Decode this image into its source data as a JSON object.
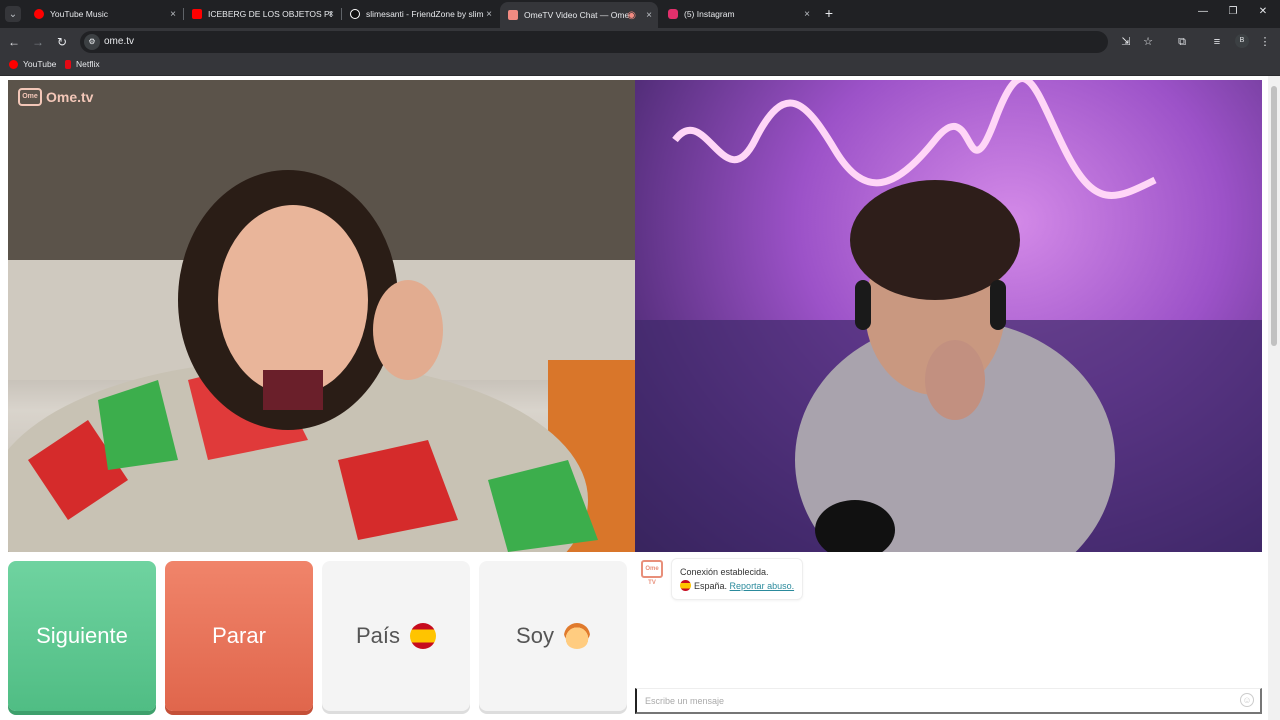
{
  "browser": {
    "tabs": [
      {
        "label": "YouTube Music",
        "favicon_color": "#ff0000"
      },
      {
        "label": "ICEBERG DE LOS OBJETOS PERI",
        "favicon_color": "#ff0000"
      },
      {
        "label": "slimesanti - FriendZone by slim",
        "favicon_color": "#ffffff"
      },
      {
        "label": "OmeTV Video Chat — Ome",
        "favicon_color": "#ffffff",
        "active": true
      },
      {
        "label": "(5) Instagram",
        "favicon_color": "#e1306c"
      }
    ],
    "tab_close": "×",
    "new_tab": "+",
    "url": "ome.tv",
    "profile_initial": "B",
    "bookmarks": [
      {
        "label": "YouTube",
        "color": "#ff0000"
      },
      {
        "label": "Netflix",
        "color": "#e50914"
      }
    ]
  },
  "page": {
    "logo_text": "Ome.tv",
    "logo_box": "Ome",
    "buttons": {
      "next": "Siguiente",
      "stop": "Parar",
      "country": "País",
      "gender": "Soy"
    },
    "chat": {
      "avatar_text": "Ome TV",
      "status": "Conexión establecida.",
      "country": "España.",
      "report": "Reportar abuso.",
      "input_placeholder": "Escribe un mensaje"
    }
  },
  "colors": {
    "next_button": "#50bd84",
    "stop_button": "#e0664c",
    "link": "#2a8a9c"
  }
}
